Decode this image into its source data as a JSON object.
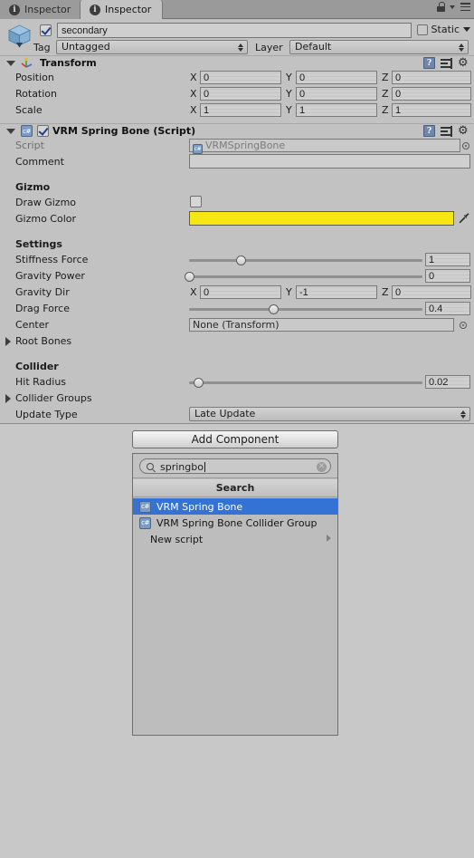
{
  "window": {
    "tabs": [
      {
        "label": "Inspector",
        "icon": "info-icon",
        "active": false
      },
      {
        "label": "Inspector",
        "icon": "info-icon",
        "active": true
      }
    ],
    "lock_icon": "lock-icon",
    "menu_icon": "hamburger-menu-icon"
  },
  "gameobject": {
    "icon": "cube-icon",
    "enabled": true,
    "name": "secondary",
    "static_label": "Static",
    "static_checked": false,
    "tag_label": "Tag",
    "tag_value": "Untagged",
    "layer_label": "Layer",
    "layer_value": "Default"
  },
  "transform": {
    "title": "Transform",
    "icon": "transform-axis-icon",
    "expanded": true,
    "rows": [
      {
        "name": "Position",
        "x": "0",
        "y": "0",
        "z": "0"
      },
      {
        "name": "Rotation",
        "x": "0",
        "y": "0",
        "z": "0"
      },
      {
        "name": "Scale",
        "x": "1",
        "y": "1",
        "z": "1"
      }
    ],
    "axis_labels": {
      "x": "X",
      "y": "Y",
      "z": "Z"
    }
  },
  "springbone": {
    "title": "VRM Spring Bone (Script)",
    "icon": "csharp-script-icon",
    "enabled": true,
    "expanded": true,
    "script_label": "Script",
    "script_value": "VRMSpringBone",
    "comment_label": "Comment",
    "comment_value": "",
    "gizmo_section": "Gizmo",
    "draw_gizmo_label": "Draw Gizmo",
    "draw_gizmo_checked": false,
    "gizmo_color_label": "Gizmo Color",
    "gizmo_color_value": "#f5e614",
    "eyedropper_icon": "eyedropper-icon",
    "settings_section": "Settings",
    "stiffness_label": "Stiffness Force",
    "stiffness_value": "1",
    "stiffness_pct": 22,
    "gravity_power_label": "Gravity Power",
    "gravity_power_value": "0",
    "gravity_power_pct": 0,
    "gravity_dir_label": "Gravity Dir",
    "gravity_dir_x": "0",
    "gravity_dir_y": "-1",
    "gravity_dir_z": "0",
    "drag_label": "Drag Force",
    "drag_value": "0.4",
    "drag_pct": 36,
    "center_label": "Center",
    "center_value": "None (Transform)",
    "root_bones_label": "Root Bones",
    "collider_section": "Collider",
    "hit_radius_label": "Hit Radius",
    "hit_radius_value": "0.02",
    "hit_radius_pct": 4,
    "collider_groups_label": "Collider Groups",
    "update_type_label": "Update Type",
    "update_type_value": "Late Update"
  },
  "add_component": {
    "button_label": "Add Component",
    "search_value": "springbo",
    "search_icon": "search-icon",
    "clear_icon": "clear-icon",
    "header": "Search",
    "results": [
      {
        "label": "VRM Spring Bone",
        "icon": "csharp-script-icon",
        "selected": true,
        "submenu": false
      },
      {
        "label": "VRM Spring Bone Collider Group",
        "icon": "csharp-script-icon",
        "selected": false,
        "submenu": false
      },
      {
        "label": "New script",
        "icon": "",
        "selected": false,
        "submenu": true
      }
    ]
  },
  "colors": {
    "selection_blue": "#3572d6",
    "panel_bg": "#c2c2c2",
    "gizmo_yellow": "#f5e614"
  }
}
